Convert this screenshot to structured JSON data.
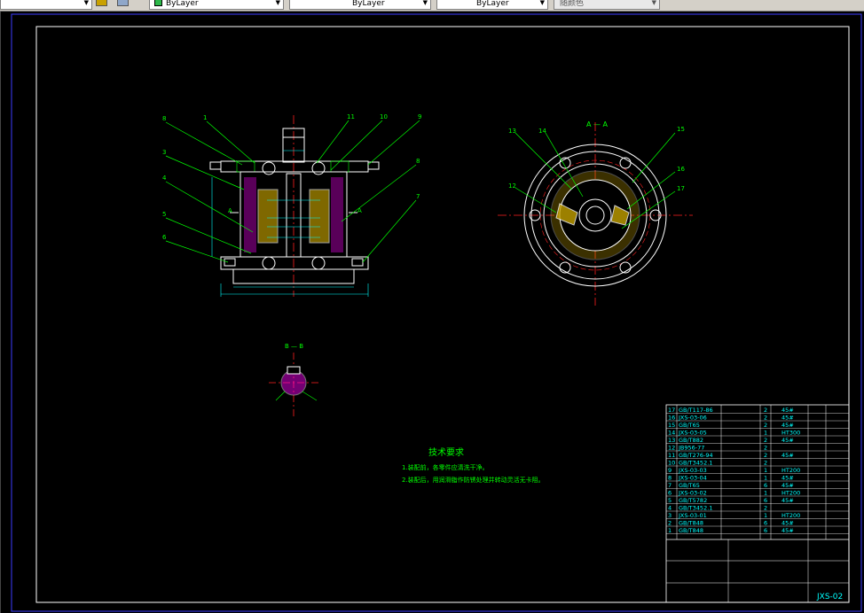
{
  "toolbar": {
    "linetype": "ByLayer",
    "lineweight": "ByLayer",
    "plotstyle": "ByLayer",
    "color_style": "随颜色"
  },
  "drawing": {
    "section_aa": "A — A",
    "section_bb": "B — B",
    "notes_title": "技术要求",
    "note1": "1.装配前，各零件应清洗干净。",
    "note2": "2.装配后，用润滑脂作防锈处理并转动灵活无卡阻。"
  },
  "colors": {
    "background": "#000000",
    "linework": "#ffffff",
    "annotation": "#00ff00",
    "centerline": "#ff0000",
    "dimension": "#00ffff",
    "hatch": "#ff00ff",
    "border": "#3d3dff"
  },
  "title_block": {
    "drawing_number": "JXS-02",
    "rows": [
      {
        "no": "17",
        "code": "GB/T117-86",
        "qty": "2",
        "mat": "45#"
      },
      {
        "no": "16",
        "code": "JXS-03-06",
        "qty": "2",
        "mat": "45#"
      },
      {
        "no": "15",
        "code": "GB/T65",
        "qty": "2",
        "mat": "45#"
      },
      {
        "no": "14",
        "code": "JXS-03-05",
        "qty": "1",
        "mat": "HT300"
      },
      {
        "no": "13",
        "code": "GB/T882",
        "qty": "2",
        "mat": "45#"
      },
      {
        "no": "12",
        "code": "JB956-77",
        "qty": "2",
        "mat": ""
      },
      {
        "no": "11",
        "code": "GB/T276-94",
        "qty": "2",
        "mat": "45#"
      },
      {
        "no": "10",
        "code": "GB/T3452.1",
        "qty": "2",
        "mat": ""
      },
      {
        "no": "9",
        "code": "JXS-03-03",
        "qty": "1",
        "mat": "HT200"
      },
      {
        "no": "8",
        "code": "JXS-03-04",
        "qty": "1",
        "mat": "45#"
      },
      {
        "no": "7",
        "code": "GB/T65",
        "qty": "6",
        "mat": "45#"
      },
      {
        "no": "6",
        "code": "JXS-03-02",
        "qty": "1",
        "mat": "HT200"
      },
      {
        "no": "5",
        "code": "GB/T5782",
        "qty": "6",
        "mat": "45#"
      },
      {
        "no": "4",
        "code": "GB/T3452.1",
        "qty": "2",
        "mat": ""
      },
      {
        "no": "3",
        "code": "JXS-03-01",
        "qty": "1",
        "mat": "HT200"
      },
      {
        "no": "2",
        "code": "GB/T848",
        "qty": "6",
        "mat": "45#"
      },
      {
        "no": "1",
        "code": "GB/T848",
        "qty": "6",
        "mat": "45#"
      }
    ]
  }
}
